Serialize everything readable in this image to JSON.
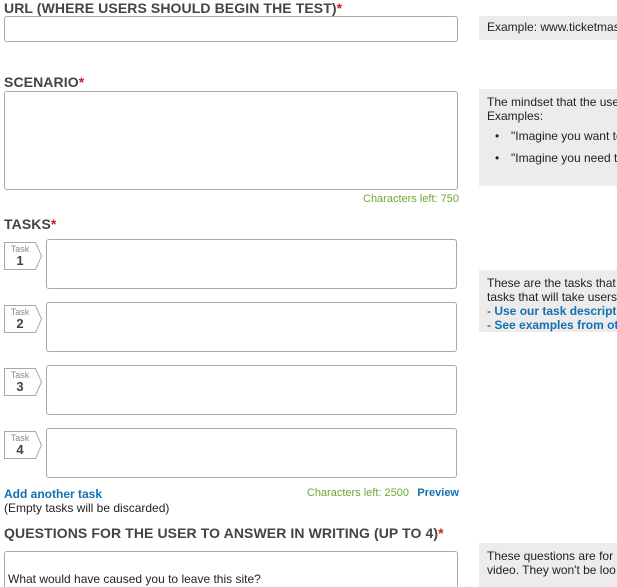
{
  "url_section": {
    "label": "URL (WHERE USERS SHOULD BEGIN THE TEST)",
    "required_mark": "*",
    "value": "",
    "help": "Example: www.ticketmas"
  },
  "scenario_section": {
    "label": "SCENARIO",
    "required_mark": "*",
    "value": "",
    "chars_left": "Characters left: 750",
    "help": {
      "line1": "The mindset that the use",
      "line2": "Examples:",
      "bullets": [
        "\"Imagine you want to",
        "\"Imagine you need to"
      ]
    }
  },
  "tasks_section": {
    "label": "TASKS",
    "required_mark": "*",
    "tag_word": "Task",
    "tasks": [
      {
        "number": "1",
        "value": ""
      },
      {
        "number": "2",
        "value": ""
      },
      {
        "number": "3",
        "value": ""
      },
      {
        "number": "4",
        "value": ""
      }
    ],
    "add_link": "Add another task",
    "empty_note": "(Empty tasks will be discarded)",
    "chars_left": "Characters left: 2500",
    "preview": "Preview",
    "help": {
      "line1": "These are the tasks that",
      "line2": "tasks that will take users",
      "link1_prefix": "- ",
      "link1": "Use our task descript",
      "link2_prefix": "- ",
      "link2": "See examples from ot"
    }
  },
  "questions_section": {
    "label": "QUESTIONS FOR THE USER TO ANSWER IN WRITING (UP TO 4)",
    "required_mark": "*",
    "question1_value": "What would have caused you to leave this site?",
    "help": {
      "line1": "These questions are for",
      "line2": "video. They won't be loo"
    }
  },
  "colors": {
    "required": "#cc1f1f",
    "link": "#1470b0",
    "char_count": "#6aa834",
    "help_bg": "#ececec"
  }
}
